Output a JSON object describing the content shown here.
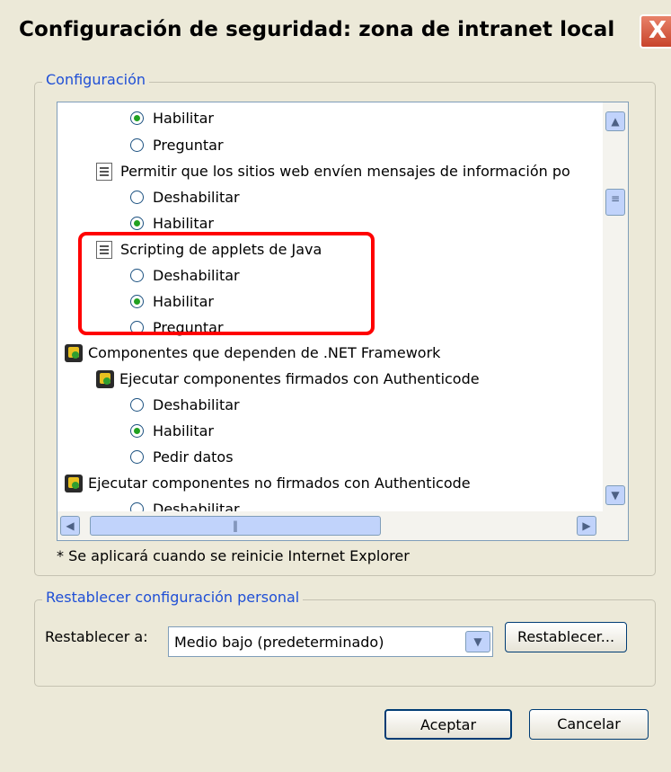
{
  "window": {
    "title": "Configuración de seguridad: zona de intranet local",
    "close_glyph": "X"
  },
  "settings_group": {
    "legend": "Configuración",
    "list_items": [
      {
        "type": "radio",
        "label": "Habilitar",
        "checked": true
      },
      {
        "type": "radio",
        "label": "Preguntar",
        "checked": false
      },
      {
        "type": "setting",
        "icon": "script-doc-icon",
        "label": "Permitir que los sitios web envíen mensajes de información po"
      },
      {
        "type": "radio",
        "label": "Deshabilitar",
        "checked": false
      },
      {
        "type": "radio",
        "label": "Habilitar",
        "checked": true
      },
      {
        "type": "setting",
        "icon": "script-doc-icon",
        "label": "Scripting de applets de Java"
      },
      {
        "type": "radio",
        "label": "Deshabilitar",
        "checked": false
      },
      {
        "type": "radio",
        "label": "Habilitar",
        "checked": true
      },
      {
        "type": "radio",
        "label": "Preguntar",
        "checked": false
      },
      {
        "type": "category",
        "icon": "net-framework-icon",
        "label": "Componentes que dependen de .NET Framework"
      },
      {
        "type": "setting",
        "icon": "net-framework-icon",
        "label": "Ejecutar componentes firmados con Authenticode"
      },
      {
        "type": "radio",
        "label": "Deshabilitar",
        "checked": false
      },
      {
        "type": "radio",
        "label": "Habilitar",
        "checked": true
      },
      {
        "type": "radio",
        "label": "Pedir datos",
        "checked": false
      },
      {
        "type": "setting",
        "icon": "net-framework-icon",
        "label": "Ejecutar componentes no firmados con Authenticode"
      },
      {
        "type": "radio",
        "label": "Deshabilitar",
        "checked": false
      }
    ],
    "note": "* Se aplicará cuando se reinicie Internet Explorer"
  },
  "reset_group": {
    "legend": "Restablecer configuración personal",
    "label": "Restablecer a:",
    "selected_value": "Medio bajo (predeterminado)",
    "reset_button": "Restablecer..."
  },
  "buttons": {
    "ok": "Aceptar",
    "cancel": "Cancelar"
  },
  "colors": {
    "highlight_box": "#ff0000",
    "legend_text": "#1f4fd6",
    "dialog_bg": "#ece9d8"
  }
}
